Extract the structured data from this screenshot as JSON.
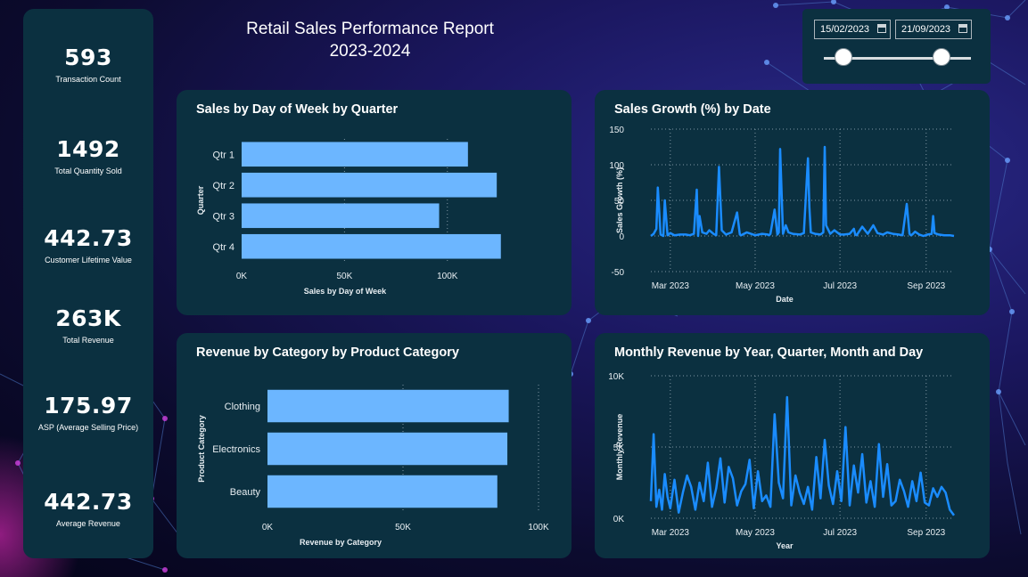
{
  "report": {
    "title_line1": "Retail Sales Performance Report",
    "title_line2": "2023-2024"
  },
  "kpis": [
    {
      "value": "593",
      "label": "Transaction Count"
    },
    {
      "value": "1492",
      "label": "Total Quantity Sold"
    },
    {
      "value": "442.73",
      "label": "Customer Lifetime Value"
    },
    {
      "value": "263K",
      "label": "Total Revenue"
    },
    {
      "value": "175.97",
      "label": "ASP (Average Selling Price)"
    },
    {
      "value": "442.73",
      "label": "Average Revenue"
    }
  ],
  "date_slicer": {
    "start": "15/02/2023",
    "end": "21/09/2023",
    "range_start_fraction": 0.0,
    "range_end_fraction": 0.78
  },
  "colors": {
    "bar": "#6cb6ff",
    "line": "#1a8cff",
    "card": "#0b3040",
    "grid": "#7f96a3"
  },
  "chart_data": [
    {
      "id": "sales_by_quarter",
      "type": "bar",
      "orientation": "horizontal",
      "title": "Sales by Day of Week by Quarter",
      "categories": [
        "Qtr 1",
        "Qtr 2",
        "Qtr 3",
        "Qtr 4"
      ],
      "values": [
        110000,
        124000,
        96000,
        126000
      ],
      "xlabel": "Sales by Day of Week",
      "ylabel": "Quarter",
      "xlim": [
        0,
        130000
      ],
      "xticks": [
        0,
        50000,
        100000
      ],
      "xtick_labels": [
        "0K",
        "50K",
        "100K"
      ],
      "grid": true
    },
    {
      "id": "sales_growth",
      "type": "line",
      "title": "Sales Growth (%) by Date",
      "xlabel": "Date",
      "ylabel": "Sales Growth (%)",
      "ylim": [
        -50,
        150
      ],
      "yticks": [
        -50,
        0,
        50,
        100,
        150
      ],
      "ytick_labels": [
        "-50",
        "0",
        "50",
        "100",
        "150"
      ],
      "xlim": [
        "2023-02-15",
        "2023-09-21"
      ],
      "xtick_dates": [
        "2023-03-01",
        "2023-05-01",
        "2023-07-01",
        "2023-09-01"
      ],
      "xtick_labels": [
        "Mar 2023",
        "May 2023",
        "Jul 2023",
        "Sep 2023"
      ],
      "x": [
        "2023-02-15",
        "2023-02-17",
        "2023-02-19",
        "2023-02-20",
        "2023-02-22",
        "2023-02-24",
        "2023-02-25",
        "2023-02-27",
        "2023-03-01",
        "2023-03-04",
        "2023-03-08",
        "2023-03-12",
        "2023-03-15",
        "2023-03-18",
        "2023-03-20",
        "2023-03-21",
        "2023-03-22",
        "2023-03-24",
        "2023-03-27",
        "2023-03-29",
        "2023-04-01",
        "2023-04-03",
        "2023-04-05",
        "2023-04-07",
        "2023-04-10",
        "2023-04-14",
        "2023-04-18",
        "2023-04-20",
        "2023-04-21",
        "2023-04-22",
        "2023-04-25",
        "2023-05-01",
        "2023-05-06",
        "2023-05-10",
        "2023-05-11",
        "2023-05-12",
        "2023-05-15",
        "2023-05-17",
        "2023-05-18",
        "2023-05-19",
        "2023-05-21",
        "2023-05-23",
        "2023-05-25",
        "2023-05-28",
        "2023-06-02",
        "2023-06-05",
        "2023-06-08",
        "2023-06-09",
        "2023-06-10",
        "2023-06-13",
        "2023-06-17",
        "2023-06-19",
        "2023-06-20",
        "2023-06-21",
        "2023-06-24",
        "2023-06-27",
        "2023-07-01",
        "2023-07-04",
        "2023-07-08",
        "2023-07-11",
        "2023-07-12",
        "2023-07-13",
        "2023-07-17",
        "2023-07-21",
        "2023-07-25",
        "2023-07-28",
        "2023-08-01",
        "2023-08-04",
        "2023-08-08",
        "2023-08-12",
        "2023-08-15",
        "2023-08-18",
        "2023-08-20",
        "2023-08-21",
        "2023-08-22",
        "2023-08-24",
        "2023-08-27",
        "2023-08-30",
        "2023-09-02",
        "2023-09-05",
        "2023-09-06",
        "2023-09-07",
        "2023-09-10",
        "2023-09-14",
        "2023-09-18",
        "2023-09-21"
      ],
      "y": [
        0,
        3,
        10,
        68,
        2,
        0,
        50,
        1,
        4,
        1,
        2,
        2,
        1,
        3,
        65,
        0,
        28,
        5,
        3,
        8,
        3,
        1,
        97,
        8,
        2,
        5,
        33,
        2,
        1,
        2,
        5,
        1,
        3,
        2,
        1,
        3,
        37,
        2,
        5,
        122,
        3,
        15,
        5,
        3,
        2,
        4,
        109,
        40,
        5,
        3,
        2,
        5,
        125,
        15,
        3,
        8,
        2,
        2,
        3,
        10,
        2,
        1,
        13,
        3,
        15,
        4,
        2,
        5,
        3,
        2,
        1,
        45,
        3,
        1,
        2,
        6,
        2,
        0,
        2,
        3,
        28,
        4,
        2,
        1,
        1,
        0
      ]
    },
    {
      "id": "revenue_by_category",
      "type": "bar",
      "orientation": "horizontal",
      "title": "Revenue by Category by Product Category",
      "categories": [
        "Clothing",
        "Electronics",
        "Beauty"
      ],
      "values": [
        89000,
        88500,
        84800
      ],
      "xlabel": "Revenue by Category",
      "ylabel": "Product Category",
      "xlim": [
        0,
        100000
      ],
      "xticks": [
        0,
        50000,
        100000
      ],
      "xtick_labels": [
        "0K",
        "50K",
        "100K"
      ],
      "grid": true
    },
    {
      "id": "monthly_revenue",
      "type": "line",
      "title": "Monthly Revenue by Year, Quarter, Month and Day",
      "xlabel": "Year",
      "ylabel": "Monthly Revenue",
      "ylim": [
        0,
        10000
      ],
      "yticks": [
        0,
        5000,
        10000
      ],
      "ytick_labels": [
        "0K",
        "5K",
        "10K"
      ],
      "xlim": [
        "2023-02-15",
        "2023-09-21"
      ],
      "xtick_dates": [
        "2023-03-01",
        "2023-05-01",
        "2023-07-01",
        "2023-09-01"
      ],
      "xtick_labels": [
        "Mar 2023",
        "May 2023",
        "Jul 2023",
        "Sep 2023"
      ],
      "x": [
        "2023-02-15",
        "2023-02-17",
        "2023-02-19",
        "2023-02-21",
        "2023-02-23",
        "2023-02-25",
        "2023-02-27",
        "2023-03-01",
        "2023-03-04",
        "2023-03-07",
        "2023-03-10",
        "2023-03-13",
        "2023-03-16",
        "2023-03-19",
        "2023-03-22",
        "2023-03-25",
        "2023-03-28",
        "2023-03-31",
        "2023-04-03",
        "2023-04-06",
        "2023-04-09",
        "2023-04-12",
        "2023-04-15",
        "2023-04-18",
        "2023-04-21",
        "2023-04-24",
        "2023-04-27",
        "2023-04-30",
        "2023-05-03",
        "2023-05-06",
        "2023-05-09",
        "2023-05-12",
        "2023-05-15",
        "2023-05-18",
        "2023-05-21",
        "2023-05-24",
        "2023-05-27",
        "2023-05-30",
        "2023-06-02",
        "2023-06-05",
        "2023-06-08",
        "2023-06-11",
        "2023-06-14",
        "2023-06-17",
        "2023-06-20",
        "2023-06-23",
        "2023-06-26",
        "2023-06-29",
        "2023-07-02",
        "2023-07-05",
        "2023-07-08",
        "2023-07-11",
        "2023-07-14",
        "2023-07-17",
        "2023-07-20",
        "2023-07-23",
        "2023-07-26",
        "2023-07-29",
        "2023-08-01",
        "2023-08-04",
        "2023-08-07",
        "2023-08-10",
        "2023-08-13",
        "2023-08-16",
        "2023-08-19",
        "2023-08-22",
        "2023-08-25",
        "2023-08-28",
        "2023-08-31",
        "2023-09-03",
        "2023-09-06",
        "2023-09-09",
        "2023-09-12",
        "2023-09-15",
        "2023-09-18",
        "2023-09-21"
      ],
      "y": [
        1200,
        5900,
        800,
        2000,
        600,
        3100,
        1500,
        700,
        2700,
        400,
        1800,
        3000,
        2200,
        600,
        2500,
        1200,
        3900,
        800,
        2100,
        4200,
        1100,
        3600,
        2800,
        900,
        1900,
        2400,
        4100,
        700,
        3300,
        1200,
        1600,
        800,
        7300,
        2500,
        1400,
        8500,
        900,
        3000,
        1800,
        1000,
        2200,
        600,
        4300,
        1400,
        5500,
        2300,
        1000,
        3300,
        1200,
        6400,
        900,
        3700,
        1800,
        4500,
        1100,
        2600,
        800,
        5200,
        1500,
        3800,
        900,
        1200,
        2700,
        1900,
        800,
        2600,
        1200,
        3200,
        1100,
        900,
        2100,
        1500,
        2200,
        1800,
        600,
        200
      ]
    }
  ]
}
